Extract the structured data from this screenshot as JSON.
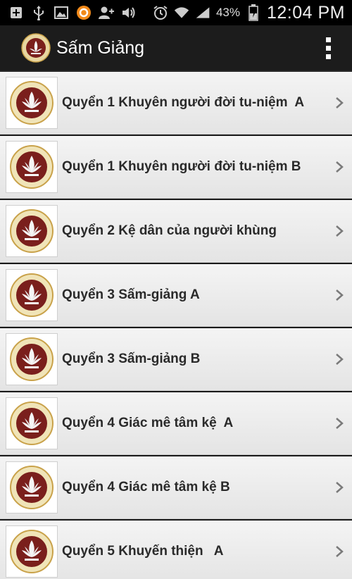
{
  "status_bar": {
    "icons": [
      "add-box-icon",
      "usb-icon",
      "image-icon",
      "orange-circle-icon",
      "add-contact-icon",
      "volume-icon",
      "alarm-icon",
      "wifi-icon",
      "signal-icon",
      "battery-icon"
    ],
    "battery_percent": "43%",
    "time": "12:04 PM"
  },
  "action_bar": {
    "title": "Sấm Giảng"
  },
  "list": {
    "items": [
      {
        "label": "Quyển 1 Khuyên người đời tu-niệm  A"
      },
      {
        "label": "Quyển 1 Khuyên người đời tu-niệm B"
      },
      {
        "label": "Quyển 2 Kệ dân của người khùng"
      },
      {
        "label": "Quyển 3 Sấm-giảng A"
      },
      {
        "label": "Quyển 3 Sấm-giảng B"
      },
      {
        "label": "Quyển 4 Giác mê tâm kệ  A"
      },
      {
        "label": "Quyển 4 Giác mê tâm kệ B"
      },
      {
        "label": "Quyển 5 Khuyến thiện   A"
      }
    ]
  },
  "colors": {
    "logo_red": "#7a1f1c",
    "logo_gold": "#c9a24a",
    "list_text": "#2a2a2a"
  }
}
